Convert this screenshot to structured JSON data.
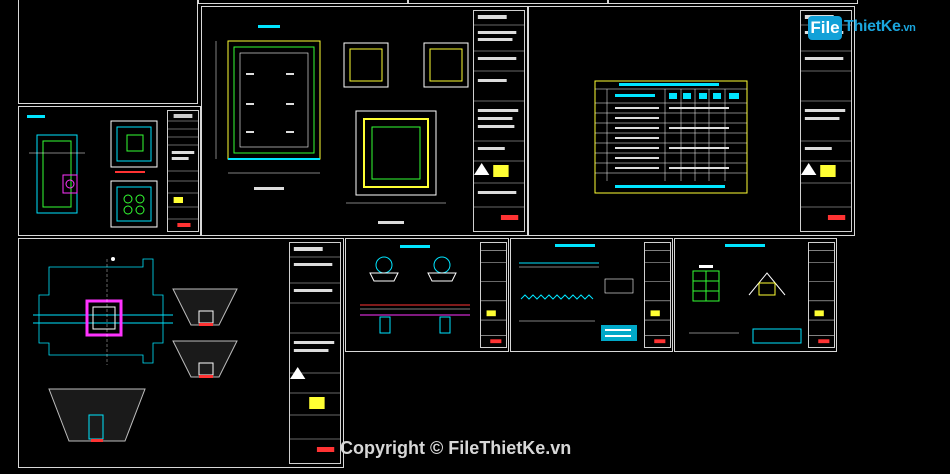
{
  "watermark": {
    "logo_box": "File",
    "logo_rest": "ThietKe",
    "logo_ext": ".vn",
    "copyright": "Copyright © FileThietKe.vn"
  },
  "colors": {
    "sheet_border": "#d8d8d8",
    "cyan": "#00e5ff",
    "yellow": "#ffff33",
    "green": "#33ff33",
    "magenta": "#ff33ff",
    "red": "#ff3333",
    "white": "#ffffff",
    "logo_blue": "#12a1d8"
  },
  "sheets": [
    "sheet-top-left-blank",
    "sheet-manhole-small",
    "sheet-plan-sections",
    "sheet-table",
    "sheet-site-plan",
    "sheet-pipe-sections",
    "sheet-long-profile",
    "sheet-details"
  ]
}
